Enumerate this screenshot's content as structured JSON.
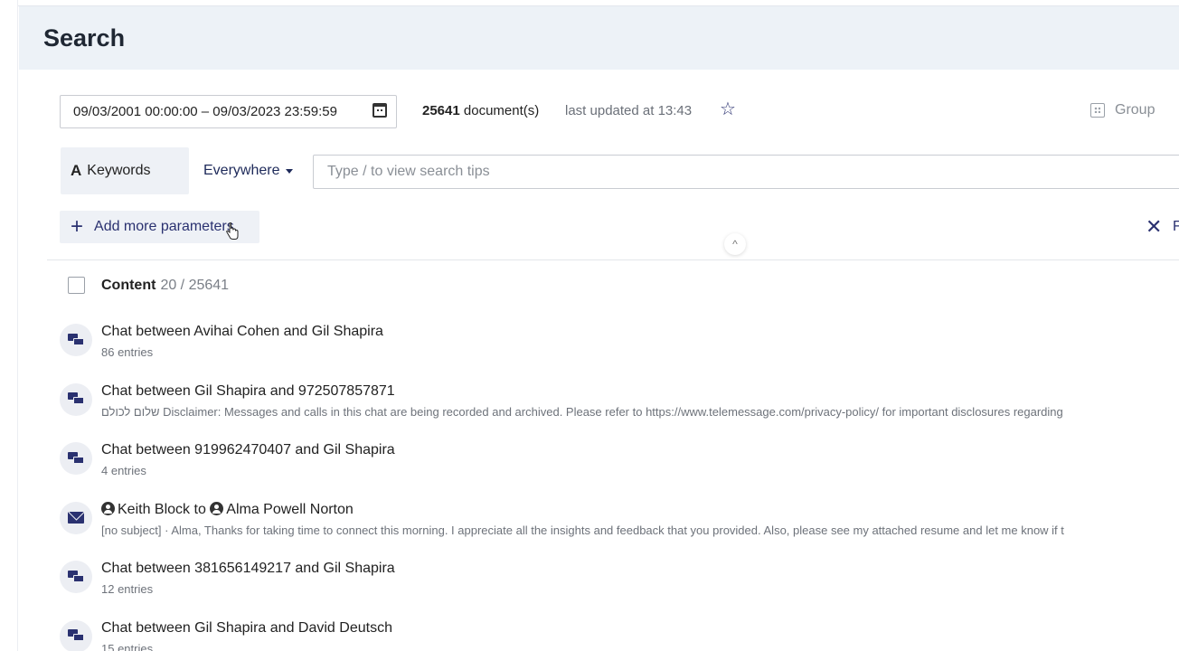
{
  "header": {
    "title": "Search"
  },
  "filters": {
    "date_range": "09/03/2001 00:00:00 – 09/03/2023 23:59:59",
    "doc_count": "25641",
    "doc_suffix": " document(s)",
    "last_updated": "last updated at 13:43",
    "group_label": "Group"
  },
  "search": {
    "mode_icon": "A",
    "mode_label": "Keywords",
    "scope": "Everywhere",
    "placeholder": "Type / to view search tips",
    "add_params_label": "Add more parameters",
    "reset_partial": "F"
  },
  "content": {
    "label": "Content",
    "count": "20 / 25641"
  },
  "results": [
    {
      "type": "chat-icon",
      "title": "Chat between Avihai Cohen and Gil Shapira",
      "sub": "86 entries"
    },
    {
      "type": "chat-icon",
      "title": "Chat between Gil Shapira and 972507857871",
      "sub": "שלום לכולם Disclaimer: Messages and calls in this chat are being recorded and archived. Please refer to https://www.telemessage.com/privacy-policy/ for important disclosures regarding"
    },
    {
      "type": "chat-icon",
      "title": "Chat between 919962470407 and Gil Shapira",
      "sub": "4 entries"
    },
    {
      "type": "email-icon",
      "from": "Keith Block",
      "to_word": " to ",
      "to": "Alma Powell Norton",
      "sub": "[no subject] · Alma, Thanks for taking time to connect this morning. I appreciate all the insights and feedback that you provided. Also, please see my attached resume and let me know if t"
    },
    {
      "type": "chat-icon",
      "title": "Chat between 381656149217 and Gil Shapira",
      "sub": "12 entries"
    },
    {
      "type": "chat-icon",
      "title": "Chat between Gil Shapira and David Deutsch",
      "sub": "15 entries"
    }
  ],
  "colors": {
    "accent": "#2a3170",
    "header_bg": "#edf2f7",
    "muted": "#6d727a"
  }
}
